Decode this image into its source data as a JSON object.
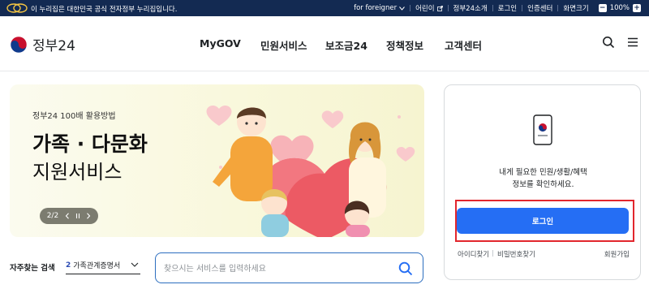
{
  "govbar": {
    "notice": "이 누리집은 대한민국 공식 전자정부 누리집입니다.",
    "foreigner": "for foreigner",
    "items": [
      "어린이",
      "정부24소개",
      "로그인",
      "인증센터",
      "화면크기"
    ],
    "zoom": "100%"
  },
  "header": {
    "logo_text": "정부24",
    "nav": [
      "MyGOV",
      "민원서비스",
      "보조금24",
      "정책정보",
      "고객센터"
    ],
    "icons": [
      "search-icon",
      "menu-icon"
    ]
  },
  "banner": {
    "eyebrow": "정부24 100배 활용방법",
    "title1": "가족 · 다문화",
    "title2": "지원서비스",
    "pager": "2/2"
  },
  "search": {
    "frequent_label": "자주찾는 검색",
    "selected_rank": "2",
    "selected_term": "가족관계증명서",
    "placeholder": "찾으시는 서비스를 입력하세요"
  },
  "login_panel": {
    "message_line1": "내게 필요한 민원/생활/혜택",
    "message_line2": "정보를 확인하세요.",
    "login_button": "로그인",
    "find_id": "아이디찾기",
    "find_pw": "비밀번호찾기",
    "signup": "회원가입"
  },
  "colors": {
    "gov_bar": "#132a52",
    "primary": "#256ef4",
    "highlight": "#e2262d"
  }
}
